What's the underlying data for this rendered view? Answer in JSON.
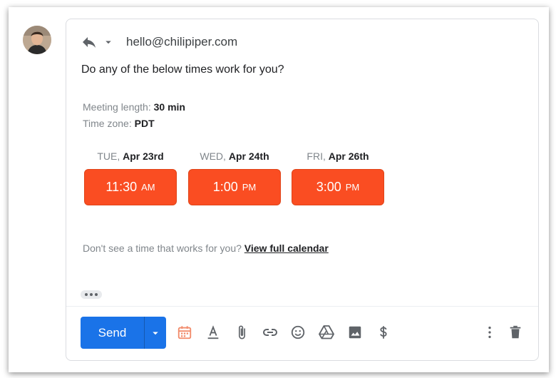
{
  "header": {
    "to": "hello@chilipiper.com"
  },
  "body": {
    "question": "Do any of the below times work for you?",
    "meeting_length_label": "Meeting length:",
    "meeting_length_value": "30 min",
    "time_zone_label": "Time zone:",
    "time_zone_value": "PDT",
    "days": [
      {
        "weekday": "TUE,",
        "date": "Apr 23rd",
        "time": "11:30",
        "ampm": "AM"
      },
      {
        "weekday": "WED,",
        "date": "Apr 24th",
        "time": "1:00",
        "ampm": "PM"
      },
      {
        "weekday": "FRI,",
        "date": "Apr 26th",
        "time": "3:00",
        "ampm": "PM"
      }
    ],
    "no_time_text": "Don't see a time that works for you?",
    "calendar_link": "View full calendar"
  },
  "toolbar": {
    "send_label": "Send",
    "icons": [
      "calendar-icon",
      "text-format-icon",
      "attachment-icon",
      "link-icon",
      "emoji-icon",
      "drive-icon",
      "image-icon",
      "dollar-icon",
      "more-options-icon",
      "delete-icon"
    ]
  },
  "colors": {
    "slot": "#fa4d22",
    "send": "#1a73e8",
    "calendar_icon": "#f28b6b",
    "muted": "#80868b",
    "icon": "#5f6368"
  }
}
